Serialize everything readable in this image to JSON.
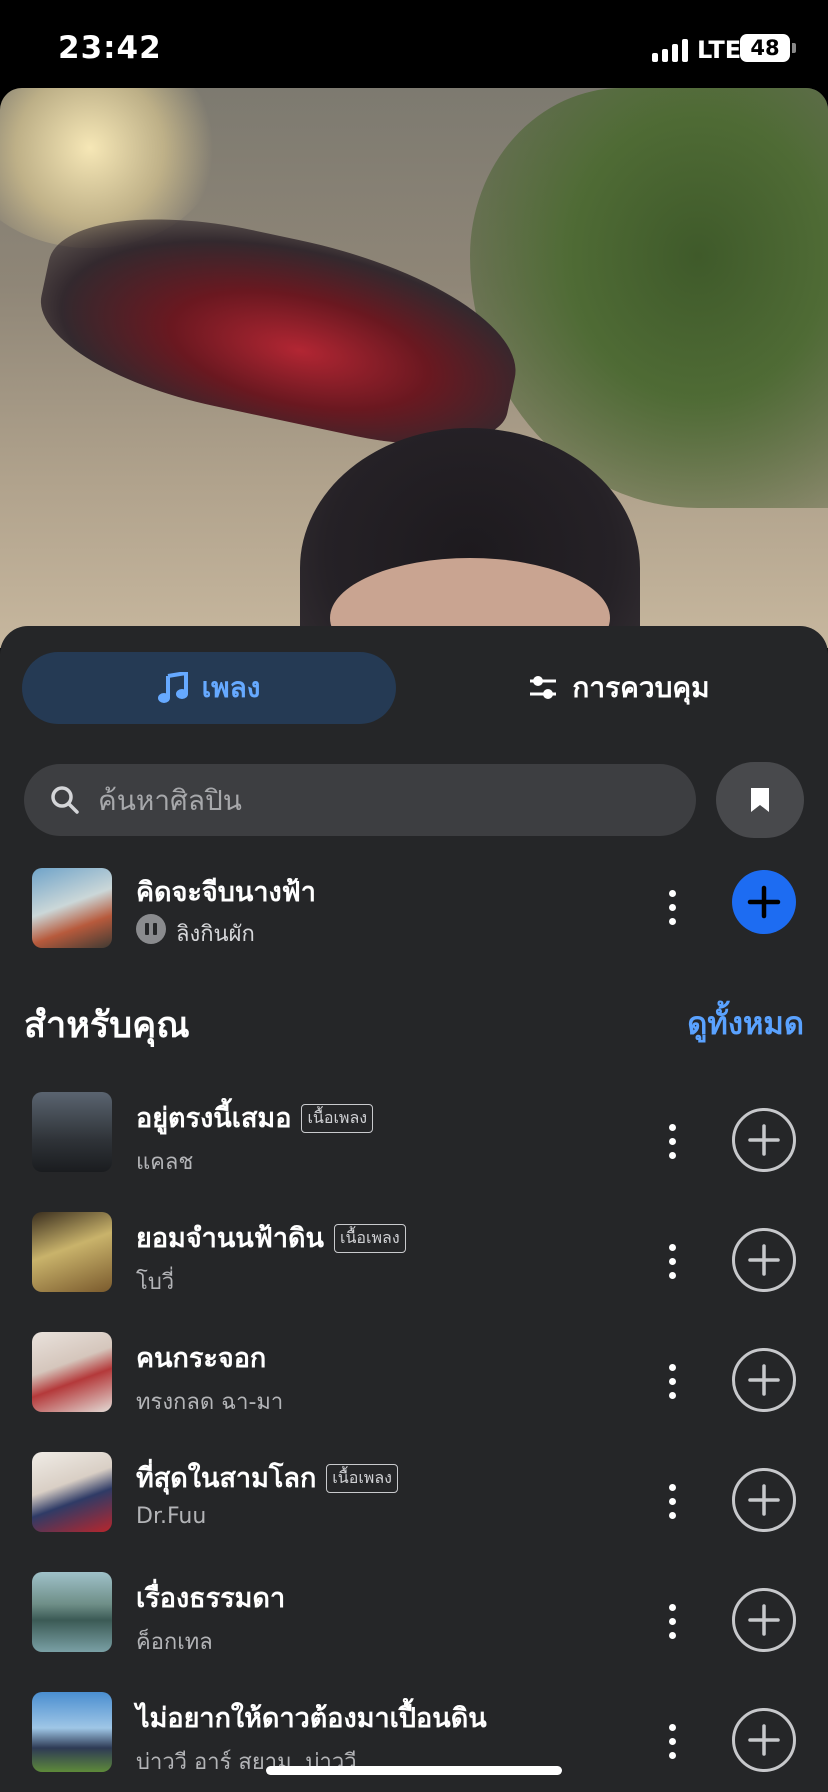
{
  "status": {
    "time": "23:42",
    "network": "LTE",
    "battery": "48"
  },
  "tabs": [
    {
      "label": "เพลง",
      "icon": "music-note-icon",
      "active": true
    },
    {
      "label": "การควบคุม",
      "icon": "sliders-icon",
      "active": false
    }
  ],
  "search": {
    "placeholder": "ค้นหาศิลปิน"
  },
  "now_playing": {
    "title": "คิดจะจีบนางฟ้า",
    "artist": "ลิงกินผัก"
  },
  "section": {
    "title": "สำหรับคุณ",
    "see_all": "ดูทั้งหมด"
  },
  "lyrics_label": "เนื้อเพลง",
  "songs": [
    {
      "title": "อยู่ตรงนี้เสมอ",
      "artist": "แคลช",
      "lyrics": true
    },
    {
      "title": "ยอมจำนนฟ้าดิน",
      "artist": "โบวี่",
      "lyrics": true
    },
    {
      "title": "คนกระจอก",
      "artist": "ทรงกลด ฉา-มา",
      "lyrics": false
    },
    {
      "title": "ที่สุดในสามโลก",
      "artist": "Dr.Fuu",
      "lyrics": true
    },
    {
      "title": "เรื่องธรรมดา",
      "artist": "ค็อกเทล",
      "lyrics": false
    },
    {
      "title": "ไม่อยากให้ดาวต้องมาเปื้อนดิน",
      "artist": "บ่าววี อาร์ สยาม, บ่าววี",
      "lyrics": false
    }
  ],
  "colors": {
    "accent": "#1d6cf2",
    "link": "#5aa2ff",
    "sheet": "#252628",
    "active_tab": "#253a54"
  }
}
